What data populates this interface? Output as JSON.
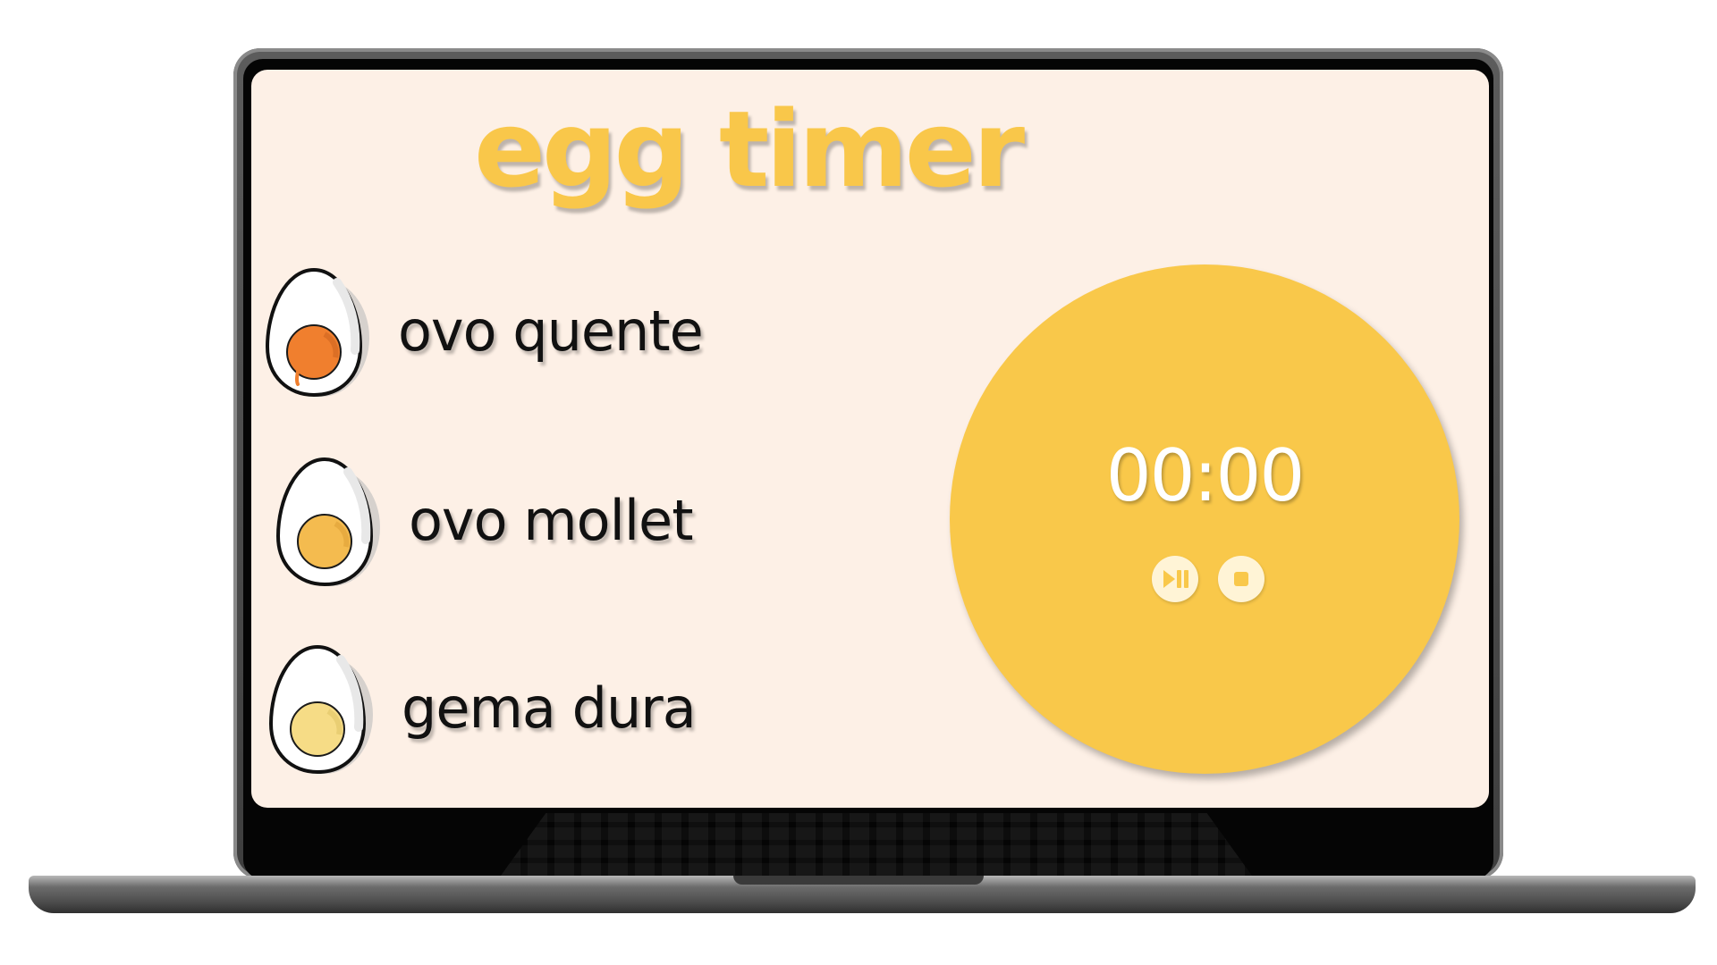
{
  "app": {
    "title": "egg timer"
  },
  "options": [
    {
      "label": "ovo quente",
      "egg_icon": "soft-boiled-egg-icon",
      "yolk_color": "#f07f2e"
    },
    {
      "label": "ovo mollet",
      "egg_icon": "medium-boiled-egg-icon",
      "yolk_color": "#f4bb4f"
    },
    {
      "label": "gema dura",
      "egg_icon": "hard-boiled-egg-icon",
      "yolk_color": "#f6dc86"
    }
  ],
  "timer": {
    "display": "00:00",
    "play_pause_icon": "play-pause-icon",
    "stop_icon": "stop-icon"
  },
  "colors": {
    "accent": "#f9c84a",
    "screen_background": "#fdf0e6",
    "label_text": "#111111",
    "timer_text": "#ffffff"
  }
}
